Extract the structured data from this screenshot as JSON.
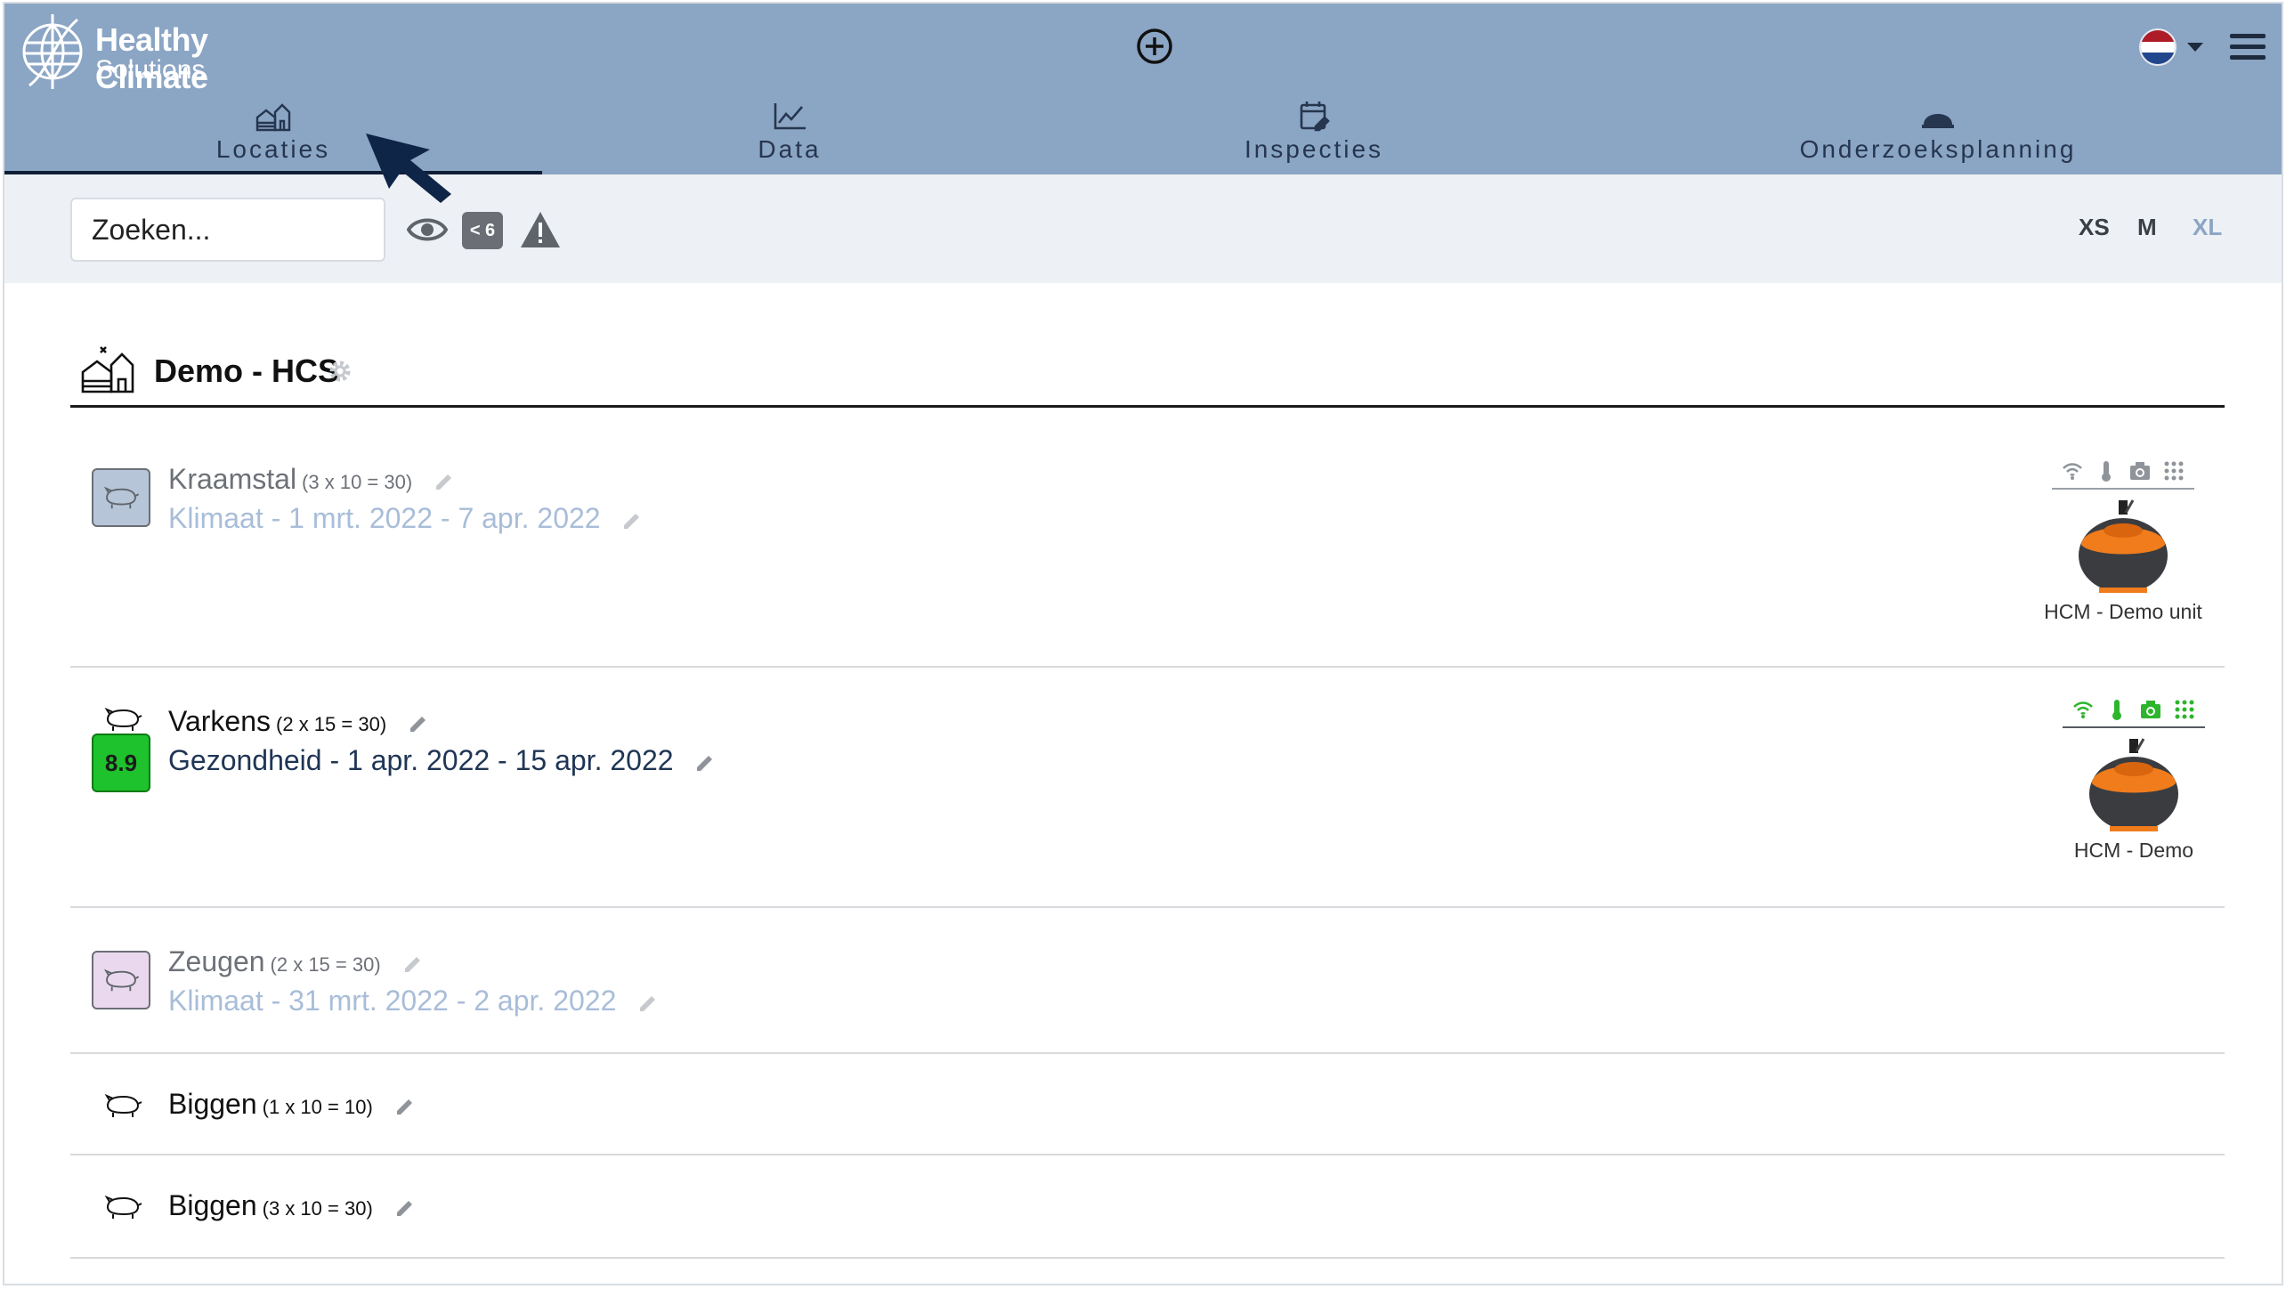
{
  "brand": {
    "line1": "Healthy Climate",
    "line2": "Solutions"
  },
  "header": {
    "add_icon": "plus-circle-icon",
    "language_flag": [
      "#ae1c28",
      "#ffffff",
      "#21468b"
    ],
    "menu_icon": "hamburger-icon"
  },
  "tabs": [
    {
      "label": "Locaties",
      "icon": "farm-icon",
      "active": true
    },
    {
      "label": "Data",
      "icon": "chart-line-icon",
      "active": false
    },
    {
      "label": "Inspecties",
      "icon": "calendar-edit-icon",
      "active": false
    },
    {
      "label": "Onderzoeksplanning",
      "icon": "dome-icon",
      "active": false
    }
  ],
  "toolbar": {
    "search_placeholder": "Zoeken...",
    "badge_label": "< 6",
    "sizes": [
      "XS",
      "M",
      "XL"
    ],
    "active_size": "XL"
  },
  "group": {
    "title": "Demo - HCS"
  },
  "rows": [
    {
      "name": "Kraamstal",
      "capacity": "(3 x 10 = 30)",
      "subtitle": "Klimaat - 1 mrt. 2022 - 7 apr. 2022",
      "square_color": "#b6c5d8",
      "device": {
        "name": "HCM - Demo unit",
        "status_color": "#8f949b"
      }
    },
    {
      "name": "Varkens",
      "capacity": "(2 x 15 = 30)",
      "subtitle": "Gezondheid - 1 apr. 2022 - 15 apr. 2022",
      "score": "8.9",
      "device": {
        "name": "HCM - Demo",
        "status_color": "#2db52d"
      }
    },
    {
      "name": "Zeugen",
      "capacity": "(2 x 15 = 30)",
      "subtitle": "Klimaat - 31 mrt. 2022 - 2 apr. 2022",
      "square_color": "#ead9ee"
    },
    {
      "name": "Biggen",
      "capacity": "(1 x 10 = 10)"
    },
    {
      "name": "Biggen",
      "capacity": "(3 x 10 = 30)"
    }
  ]
}
